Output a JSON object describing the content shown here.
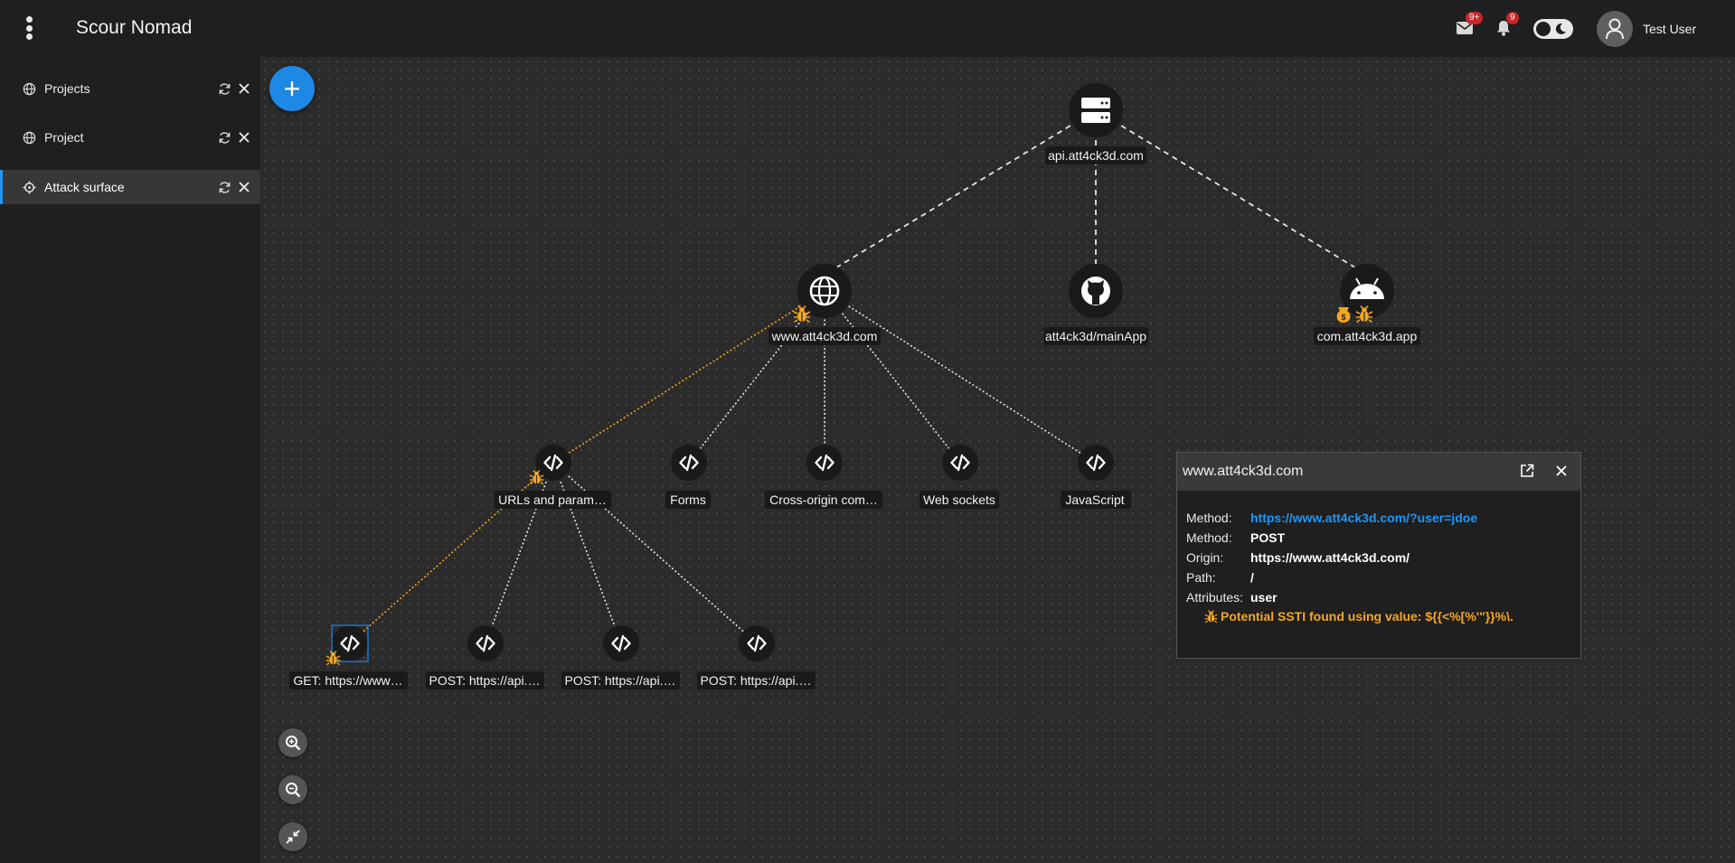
{
  "app": {
    "title": "Scour Nomad"
  },
  "header": {
    "mail_badge": "9+",
    "notifications_badge": "9",
    "user_name": "Test User"
  },
  "sidebar": {
    "items": [
      {
        "label": "Projects",
        "icon": "globe-icon",
        "active": false
      },
      {
        "label": "Project",
        "icon": "globe-icon",
        "active": false
      },
      {
        "label": "Attack surface",
        "icon": "crosshair-icon",
        "active": true
      }
    ]
  },
  "graph": {
    "nodes": {
      "api_host": {
        "label": "api.att4ck3d.com",
        "icon": "server-icon"
      },
      "website": {
        "label": "www.att4ck3d.com",
        "icon": "globe-icon",
        "findings": [
          "bug-icon"
        ]
      },
      "github": {
        "label": "att4ck3d/mainApp",
        "icon": "github-icon"
      },
      "android": {
        "label": "com.att4ck3d.app",
        "icon": "android-icon",
        "findings": [
          "money-bag-icon",
          "bug-icon"
        ]
      },
      "urls": {
        "label": "URLs and param…",
        "icon": "code-icon",
        "findings": [
          "bug-icon"
        ]
      },
      "forms": {
        "label": "Forms",
        "icon": "code-icon"
      },
      "cors": {
        "label": "Cross-origin com…",
        "icon": "code-icon"
      },
      "websockets": {
        "label": "Web sockets",
        "icon": "code-icon"
      },
      "javascript": {
        "label": "JavaScript",
        "icon": "code-icon"
      },
      "get_req": {
        "label": "GET: https://www…",
        "icon": "code-icon",
        "findings": [
          "bug-icon"
        ],
        "selected": true
      },
      "post1": {
        "label": "POST: https://api.…",
        "icon": "code-icon"
      },
      "post2": {
        "label": "POST: https://api.…",
        "icon": "code-icon"
      },
      "post3": {
        "label": "POST: https://api.…",
        "icon": "code-icon"
      }
    },
    "colors": {
      "edge": "#e0e0e0",
      "highlight_edge": "#f5a623",
      "node": "#1a1a1a",
      "label_bg": "#1a1a1a"
    }
  },
  "detail_panel": {
    "title": "www.att4ck3d.com",
    "rows": [
      {
        "key": "Method:",
        "value": "https://www.att4ck3d.com/?user=jdoe",
        "link": true
      },
      {
        "key": "Method:",
        "value": "POST"
      },
      {
        "key": "Origin:",
        "value": "https://www.att4ck3d.com/"
      },
      {
        "key": "Path:",
        "value": "/"
      },
      {
        "key": "Attributes:",
        "value": "user"
      }
    ],
    "finding": "Potential SSTI found using value: ${{<%[%'\"}}%\\."
  },
  "colors": {
    "accent": "#1e88e5",
    "finding": "#f5a623",
    "badge": "#c62828"
  }
}
